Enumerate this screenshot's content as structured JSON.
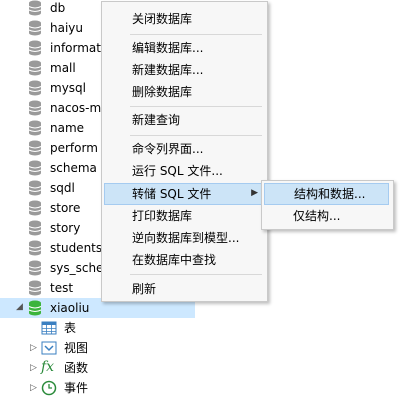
{
  "tree": {
    "databases": [
      "db",
      "haiyu",
      "informat",
      "mall",
      "mysql",
      "nacos-m",
      "name",
      "perform",
      "schema",
      "sqdl",
      "store",
      "story",
      "students",
      "sys_sche",
      "test"
    ],
    "selected_db": "xiaoliu",
    "children": [
      {
        "label": "表",
        "icon": "table-icon"
      },
      {
        "label": "视图",
        "icon": "view-icon"
      },
      {
        "label": "函数",
        "icon": "function-icon"
      },
      {
        "label": "事件",
        "icon": "event-clock-icon"
      }
    ]
  },
  "context_menu": {
    "items": [
      {
        "label": "关闭数据库",
        "sep_after": true
      },
      {
        "label": "编辑数据库..."
      },
      {
        "label": "新建数据库..."
      },
      {
        "label": "删除数据库",
        "sep_after": true
      },
      {
        "label": "新建查询",
        "sep_after": true
      },
      {
        "label": "命令列界面..."
      },
      {
        "label": "运行 SQL 文件..."
      },
      {
        "label": "转储 SQL 文件",
        "has_submenu": true,
        "highlighted": true
      },
      {
        "label": "打印数据库"
      },
      {
        "label": "逆向数据库到模型..."
      },
      {
        "label": "在数据库中查找",
        "sep_after": true
      },
      {
        "label": "刷新"
      }
    ]
  },
  "submenu": {
    "items": [
      {
        "label": "结构和数据...",
        "highlighted": true
      },
      {
        "label": "仅结构..."
      }
    ]
  },
  "colors": {
    "db_icon": "#9a9a9a",
    "selected_db_icon": "#3cb43c",
    "selection": "#cde8ff",
    "menu_hover": "#cce4f7"
  }
}
